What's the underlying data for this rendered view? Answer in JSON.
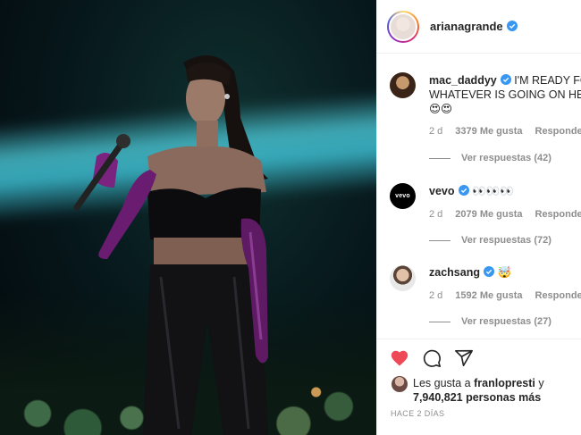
{
  "post": {
    "username": "arianagrande"
  },
  "comments": [
    {
      "username": "mac_daddyy",
      "text": "I'M READY FOR WHATEVER IS GOING ON HERE",
      "emoji": "😍😍",
      "age": "2 d",
      "likes": "3379 Me gusta",
      "reply_label": "Responder",
      "view_replies": "Ver respuestas (42)"
    },
    {
      "username": "vevo",
      "text": "👀👀👀",
      "emoji": "",
      "age": "2 d",
      "likes": "2079 Me gusta",
      "reply_label": "Responder",
      "view_replies": "Ver respuestas (72)"
    },
    {
      "username": "zachsang",
      "text": "🤯",
      "emoji": "",
      "age": "2 d",
      "likes": "1592 Me gusta",
      "reply_label": "Responder",
      "view_replies": "Ver respuestas (27)"
    }
  ],
  "actions": {
    "like_icon": "heart-filled-icon",
    "comment_icon": "comment-icon",
    "share_icon": "share-icon",
    "like_color": "#ed4956"
  },
  "likes_summary": {
    "prefix": "Les gusta a",
    "first_user": "franlopresti",
    "joiner": "y",
    "count": "7,940,821 personas más"
  },
  "timestamp": "HACE 2 DÍAS",
  "colors": {
    "verified": "#3897f0",
    "secondary_text": "#8e8e8e",
    "primary_text": "#262626"
  }
}
